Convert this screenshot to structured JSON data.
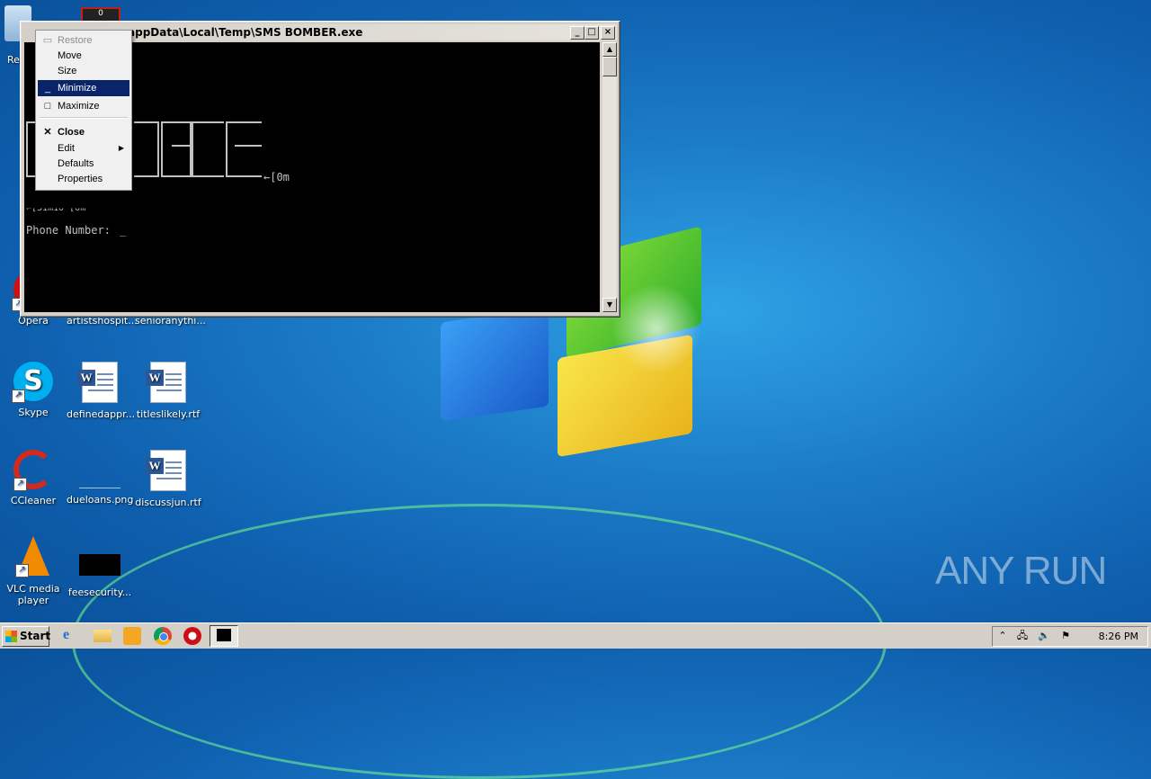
{
  "desktop": {
    "icons": [
      {
        "id": "recycle",
        "label": "Re"
      },
      {
        "id": "opera",
        "label": "Opera"
      },
      {
        "id": "artists",
        "label": "artistshospit..."
      },
      {
        "id": "senior",
        "label": "senioranythi..."
      },
      {
        "id": "skype",
        "label": "Skype"
      },
      {
        "id": "defined",
        "label": "definedappr..."
      },
      {
        "id": "titles",
        "label": "titleslikely.rtf"
      },
      {
        "id": "ccleaner",
        "label": "CCleaner"
      },
      {
        "id": "dueloans",
        "label": "dueloans.png"
      },
      {
        "id": "discuss",
        "label": "discussjun.rtf"
      },
      {
        "id": "vlc",
        "label": "VLC media player"
      },
      {
        "id": "fees",
        "label": "feesecurity..."
      }
    ],
    "watermark": "ANY RUN"
  },
  "console_window": {
    "title": "appData\\Local\\Temp\\SMS BOMBER.exe",
    "buttons": {
      "minimize": "_",
      "maximize": "□",
      "close": "×"
    },
    "escape_text": "←[0m",
    "partial_line": "←[31m10 [0m",
    "prompt": "Phone Number:",
    "cursor": "_"
  },
  "context_menu": {
    "items": [
      {
        "label": "Restore",
        "icon": "restore-icon",
        "state": "disabled"
      },
      {
        "label": "Move",
        "icon": "",
        "state": "normal"
      },
      {
        "label": "Size",
        "icon": "",
        "state": "normal"
      },
      {
        "label": "Minimize",
        "icon": "minimize-icon",
        "state": "selected"
      },
      {
        "label": "Maximize",
        "icon": "maximize-icon",
        "state": "normal"
      },
      {
        "label": "Close",
        "icon": "close-icon",
        "state": "bold"
      },
      {
        "label": "Edit",
        "icon": "",
        "state": "submenu"
      },
      {
        "label": "Defaults",
        "icon": "",
        "state": "normal"
      },
      {
        "label": "Properties",
        "icon": "",
        "state": "normal"
      }
    ]
  },
  "taskbar": {
    "start_label": "Start",
    "clock": "8:26 PM",
    "pinned": [
      "internet-explorer-icon",
      "explorer-icon",
      "media-player-icon",
      "chrome-icon",
      "opera-icon",
      "console-app-icon"
    ]
  },
  "colors": {
    "menu_selected": "#0a246a",
    "console_bg": "#000000",
    "console_fg": "#c0c0c0"
  }
}
